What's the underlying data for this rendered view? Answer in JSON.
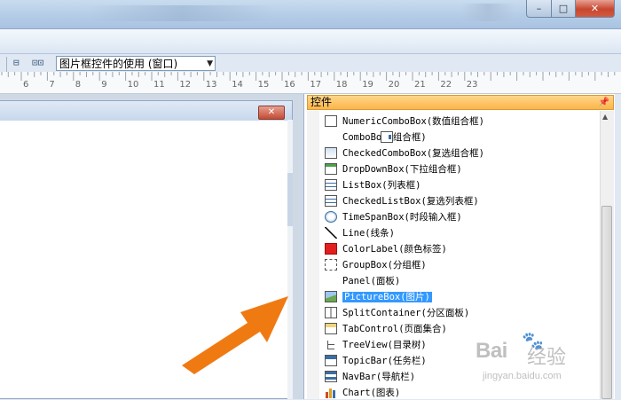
{
  "window": {
    "buttons": {
      "minimize": "–",
      "maximize": "□",
      "close": "✕"
    }
  },
  "toolbar": {
    "combo_value": "图片框控件的使用 (窗口)",
    "icons": [
      "align-icon",
      "distribute-icon"
    ]
  },
  "ruler": {
    "labels": [
      "6",
      "7",
      "8",
      "9",
      "10",
      "11",
      "12",
      "13",
      "14",
      "15",
      "16",
      "17",
      "18",
      "19",
      "20",
      "21",
      "22",
      "23"
    ]
  },
  "form": {
    "close_label": "✕"
  },
  "panel": {
    "title": "控件",
    "pin": "ᵖ",
    "items": [
      {
        "label": "NumericComboBox(数值组合框)",
        "icon": "numeric-combobox-icon",
        "icon_class": "grid"
      },
      {
        "label": "ComboBox(组合框)",
        "icon": "combobox-icon",
        "icon_class": "combo"
      },
      {
        "label": "CheckedComboBox(复选组合框)",
        "icon": "checked-combobox-icon",
        "icon_class": "checkcombo"
      },
      {
        "label": "DropDownBox(下拉组合框)",
        "icon": "dropdownbox-icon",
        "icon_class": "dropdown"
      },
      {
        "label": "ListBox(列表框)",
        "icon": "listbox-icon",
        "icon_class": "list"
      },
      {
        "label": "CheckedListBox(复选列表框)",
        "icon": "checked-listbox-icon",
        "icon_class": "list"
      },
      {
        "label": "TimeSpanBox(时段输入框)",
        "icon": "clock-icon",
        "icon_class": "clock"
      },
      {
        "label": "Line(线条)",
        "icon": "line-icon",
        "icon_class": "line"
      },
      {
        "label": "ColorLabel(颜色标签)",
        "icon": "color-label-icon",
        "icon_class": "colorlabel"
      },
      {
        "label": "GroupBox(分组框)",
        "icon": "groupbox-icon",
        "icon_class": "groupbox"
      },
      {
        "label": "Panel(面板)",
        "icon": "panel-icon",
        "icon_class": "panel"
      },
      {
        "label": "PictureBox(图片)",
        "icon": "picture-icon",
        "icon_class": "picture",
        "selected": true
      },
      {
        "label": "SplitContainer(分区面板)",
        "icon": "split-container-icon",
        "icon_class": "split"
      },
      {
        "label": "TabControl(页面集合)",
        "icon": "tab-control-icon",
        "icon_class": "tab"
      },
      {
        "label": "TreeView(目录树)",
        "icon": "treeview-icon",
        "icon_class": "tree"
      },
      {
        "label": "TopicBar(任务栏)",
        "icon": "topicbar-icon",
        "icon_class": "topic"
      },
      {
        "label": "NavBar(导航栏)",
        "icon": "navbar-icon",
        "icon_class": "navbar"
      },
      {
        "label": "Chart(图表)",
        "icon": "chart-icon",
        "icon_class": "chart"
      }
    ]
  },
  "watermark": {
    "brand": "Bai",
    "brand2": "经验",
    "url": "jingyan.baidu.com"
  },
  "colors": {
    "accent_arrow": "#f07a12",
    "selection": "#3399ff",
    "panel_header": "#fbb54a"
  }
}
